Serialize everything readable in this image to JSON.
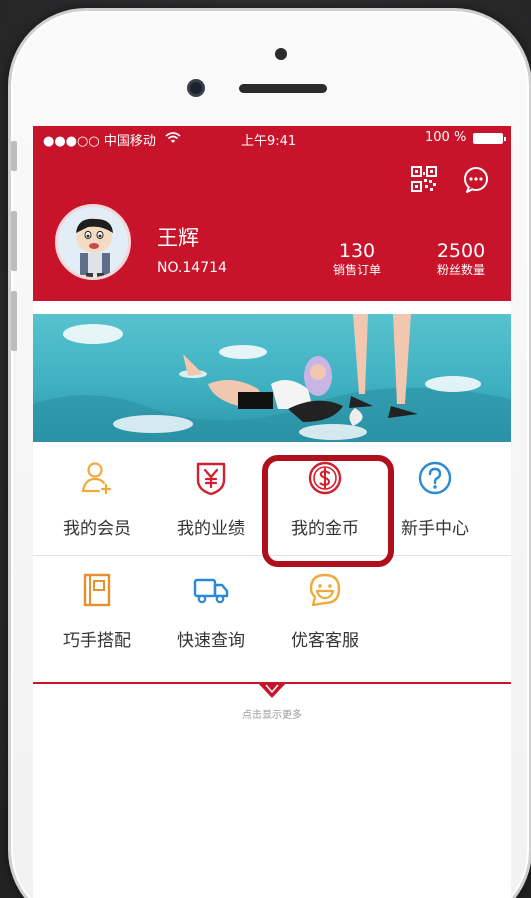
{
  "status_bar": {
    "carrier": "●●●○○ 中国移动",
    "time": "上午9:41",
    "battery": "100 %"
  },
  "header": {
    "qr_icon": "qr-code-icon",
    "message_icon": "chat-bubble-icon",
    "user": {
      "name": "王辉",
      "number": "NO.14714"
    },
    "stats": [
      {
        "value": "130",
        "label": "销售订单"
      },
      {
        "value": "2500",
        "label": "粉丝数量"
      }
    ],
    "color": "#c8142a"
  },
  "menu": {
    "row1": [
      {
        "label": "我的会员",
        "icon": "user-add-icon",
        "color": "#f0a93b"
      },
      {
        "label": "我的业绩",
        "icon": "yen-shield-icon",
        "color": "#d3202e"
      },
      {
        "label": "我的金币",
        "icon": "dollar-coin-icon",
        "color": "#d3202e"
      },
      {
        "label": "新手中心",
        "icon": "help-circle-icon",
        "color": "#2a8ad8"
      }
    ],
    "row2": [
      {
        "label": "巧手搭配",
        "icon": "book-icon",
        "color": "#e8902f"
      },
      {
        "label": "快速查询",
        "icon": "delivery-truck-icon",
        "color": "#2a8ad8"
      },
      {
        "label": "优客客服",
        "icon": "smile-bubble-icon",
        "color": "#f0a93b"
      }
    ]
  },
  "more_text": "点击显示更多"
}
